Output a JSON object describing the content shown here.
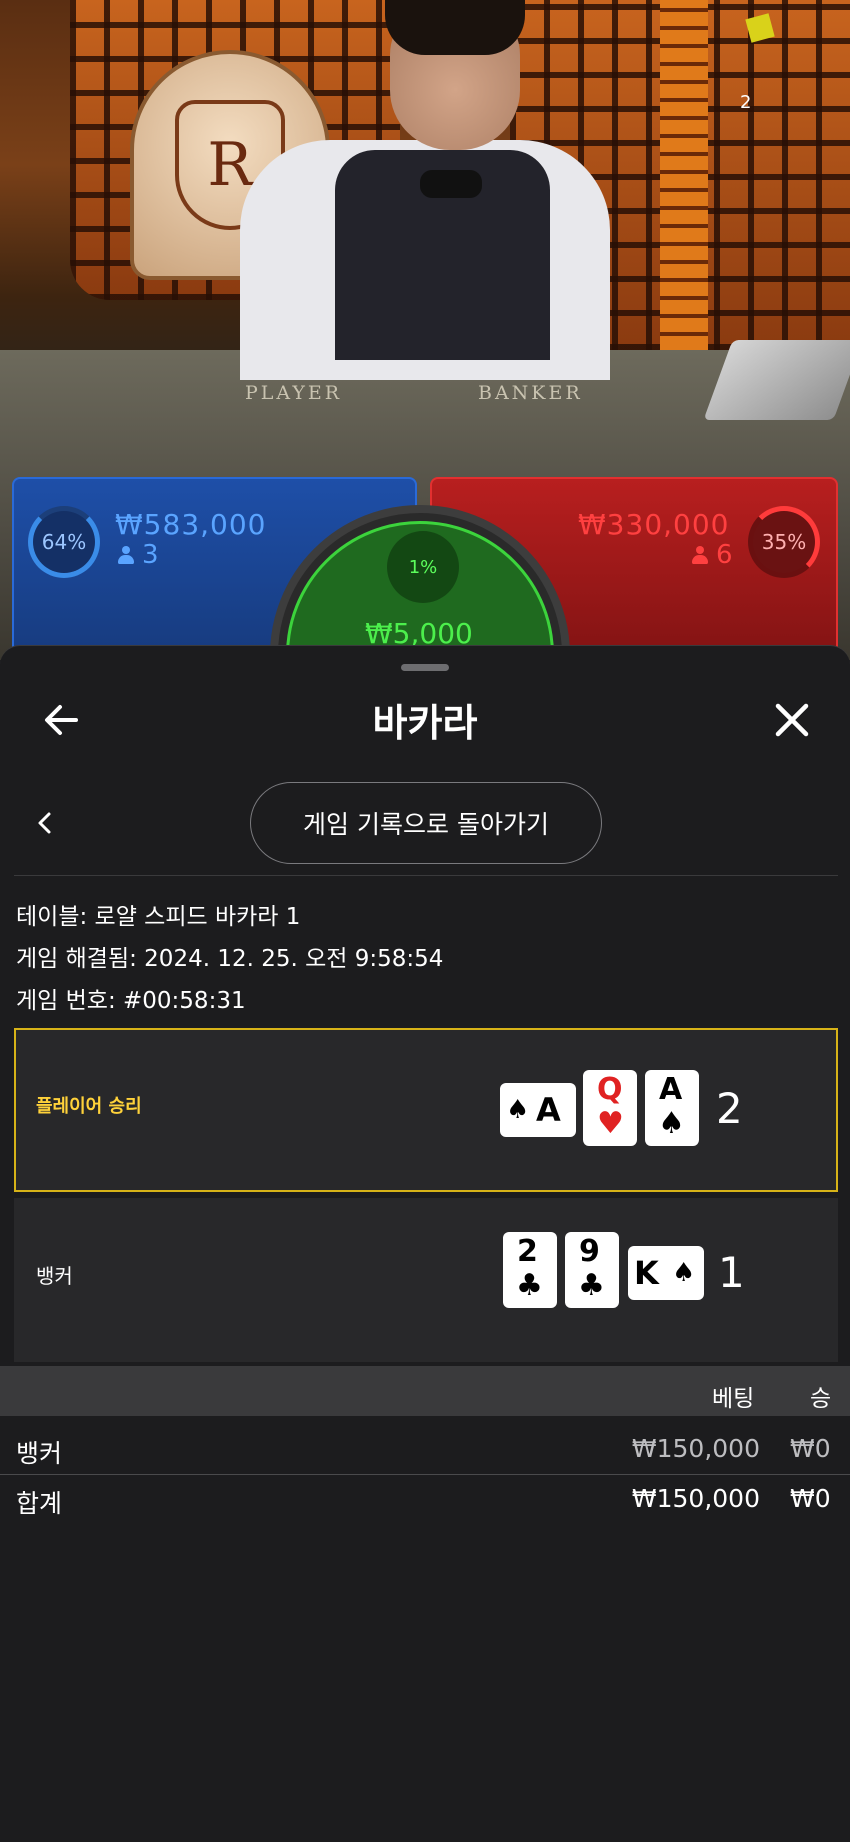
{
  "video": {
    "felt_player": "PLAYER",
    "felt_banker": "BANKER",
    "logo_letter": "R",
    "stream_number": "2"
  },
  "bets": {
    "player": {
      "percent": "64%",
      "amount": "₩583,000",
      "count": "3",
      "color": "#1e4fa8"
    },
    "banker": {
      "percent": "35%",
      "amount": "₩330,000",
      "count": "6",
      "color": "#b81f1f"
    },
    "tie": {
      "percent": "1%",
      "amount": "₩5,000",
      "color": "#1f6a1f"
    }
  },
  "sheet": {
    "title": "바카라",
    "back_icon": "arrow-left-icon",
    "close_icon": "close-icon",
    "history_button": "게임 기록으로 돌아가기",
    "info": {
      "table": "테이블: 로얄 스피드 바카라 1",
      "resolved": "게임 해결됨: 2024. 12. 25. 오전 9:58:54",
      "round": "게임 번호: #00:58:31"
    },
    "player_result": {
      "label": "플레이어 승리",
      "score": "2",
      "highlight_color": "#d7b318",
      "cards": [
        {
          "rank": "A",
          "suit": "♠",
          "orientation": "sideways"
        },
        {
          "rank": "Q",
          "suit": "♥",
          "orientation": "upright"
        },
        {
          "rank": "A",
          "suit": "♠",
          "orientation": "upright"
        }
      ]
    },
    "banker_result": {
      "label": "뱅커",
      "score": "1",
      "cards": [
        {
          "rank": "2",
          "suit": "♣",
          "orientation": "upright"
        },
        {
          "rank": "9",
          "suit": "♣",
          "orientation": "upright"
        },
        {
          "rank": "K",
          "suit": "♠",
          "orientation": "sideways"
        }
      ]
    },
    "bets_table": {
      "headers": [
        "베팅",
        "승"
      ],
      "rows": [
        {
          "label": "뱅커",
          "bet": "₩150,000",
          "win": "₩0"
        },
        {
          "label": "합계",
          "bet": "₩150,000",
          "win": "₩0"
        }
      ]
    }
  }
}
